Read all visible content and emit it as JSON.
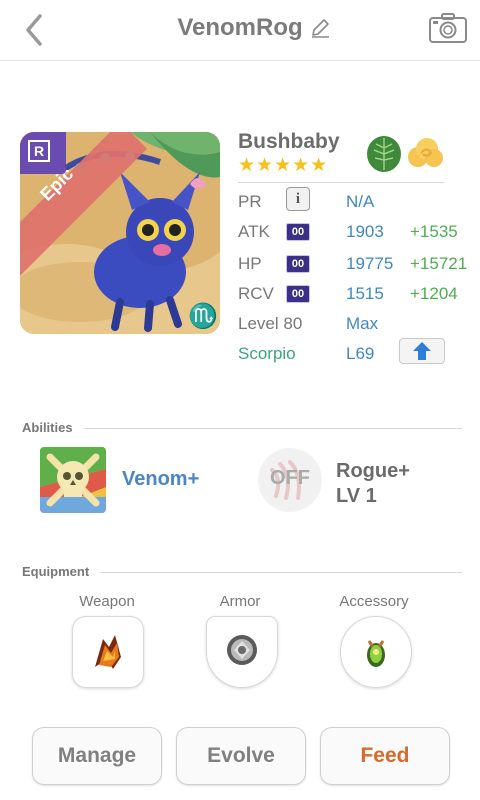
{
  "header": {
    "title": "VenomRog"
  },
  "monster": {
    "name": "Bushbaby",
    "stars": "★★★★★",
    "rarity": "Epic",
    "rank_badge": "R",
    "zodiac_glyph": "♏"
  },
  "stats": {
    "pr": {
      "label": "PR",
      "value": "N/A",
      "info_glyph": "i"
    },
    "atk": {
      "label": "ATK",
      "badge": "00",
      "value": "1903",
      "bonus": "+1535"
    },
    "hp": {
      "label": "HP",
      "badge": "00",
      "value": "19775",
      "bonus": "+15721"
    },
    "rcv": {
      "label": "RCV",
      "badge": "00",
      "value": "1515",
      "bonus": "+1204"
    },
    "level": {
      "label": "Level 80",
      "value": "Max"
    },
    "sign": {
      "label": "Scorpio",
      "value": "L69"
    }
  },
  "abilities": {
    "section_label": "Abilities",
    "items": [
      {
        "name": "Venom+"
      },
      {
        "status": "OFF",
        "name_line1": "Rogue+",
        "name_line2": "LV 1"
      }
    ]
  },
  "equipment": {
    "section_label": "Equipment",
    "slots": [
      {
        "label": "Weapon"
      },
      {
        "label": "Armor"
      },
      {
        "label": "Accessory"
      }
    ]
  },
  "actions": {
    "manage": "Manage",
    "evolve": "Evolve",
    "feed": "Feed"
  },
  "colors": {
    "stat_value": "#3f88c5",
    "stat_bonus": "#4caf50",
    "scorpio": "#3aa57a",
    "feed": "#d86a2a",
    "star": "#f4c21a"
  }
}
